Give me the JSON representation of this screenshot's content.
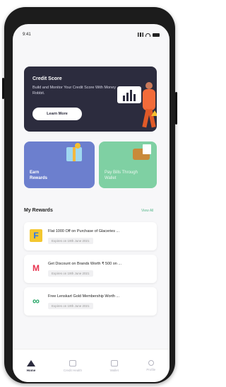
{
  "status_bar": {
    "time": "9:41"
  },
  "credit_card": {
    "title": "Credit Score",
    "description": "Build and Monitor Your Credit Score With Money Robbit.",
    "button_label": "Learn More"
  },
  "tiles": {
    "earn_label": "Earn Rewards",
    "bills_label": "Pay Bills Through Wallet"
  },
  "rewards": {
    "title": "My Rewards",
    "view_all": "View All",
    "items": [
      {
        "text": "Flat 1000 Off on Purchase of Glaceries ...",
        "expiry": "Expires on 19th June 2021",
        "logo": "F",
        "color": "#f3c730"
      },
      {
        "text": "Get Discount on Brands Worth ₹ 500 on ...",
        "expiry": "Expires on 19th June 2021",
        "logo": "M",
        "color": "#e8334f"
      },
      {
        "text": "Free Lenskart Gold Membership Worth ...",
        "expiry": "Expires on 19th June 2021",
        "logo": "∞",
        "color": "#2aa86a"
      }
    ]
  },
  "bottom_nav": [
    {
      "label": "Home",
      "icon": "home-icon",
      "active": true
    },
    {
      "label": "Credit Health",
      "icon": "card-icon",
      "active": false
    },
    {
      "label": "Wallet",
      "icon": "wallet-icon",
      "active": false
    },
    {
      "label": "Profile",
      "icon": "profile-icon",
      "active": false
    }
  ]
}
